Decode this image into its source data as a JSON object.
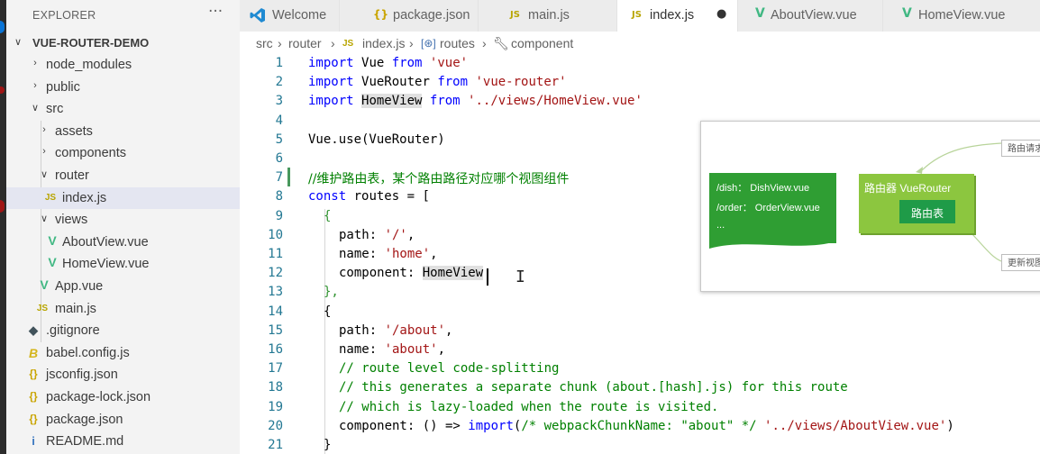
{
  "sidebar": {
    "title": "EXPLORER",
    "more": "···",
    "project": "VUE-ROUTER-DEMO",
    "items": [
      {
        "label": "node_modules"
      },
      {
        "label": "public"
      },
      {
        "label": "src"
      },
      {
        "label": "assets"
      },
      {
        "label": "components"
      },
      {
        "label": "router"
      },
      {
        "label": "index.js",
        "icon": "JS"
      },
      {
        "label": "views"
      },
      {
        "label": "AboutView.vue",
        "icon": "V"
      },
      {
        "label": "HomeView.vue",
        "icon": "V"
      },
      {
        "label": "App.vue",
        "icon": "V"
      },
      {
        "label": "main.js",
        "icon": "JS"
      },
      {
        "label": ".gitignore",
        "icon": "◆"
      },
      {
        "label": "babel.config.js",
        "icon": "B"
      },
      {
        "label": "jsconfig.json",
        "icon": "{}"
      },
      {
        "label": "package-lock.json",
        "icon": "{}"
      },
      {
        "label": "package.json",
        "icon": "{}"
      },
      {
        "label": "README.md",
        "icon": "i"
      }
    ]
  },
  "tabs": [
    {
      "label": "Welcome",
      "icon": "vscode-icon"
    },
    {
      "label": "package.json",
      "icon": "{}"
    },
    {
      "label": "main.js",
      "icon": "JS"
    },
    {
      "label": "index.js",
      "icon": "JS",
      "modified_dot": "●"
    },
    {
      "label": "AboutView.vue",
      "icon": "V"
    },
    {
      "label": "HomeView.vue",
      "icon": "V"
    }
  ],
  "breadcrumb": {
    "parts": [
      "src",
      "router",
      "index.js",
      "routes",
      "component"
    ],
    "sep": "›"
  },
  "code": {
    "line_numbers": [
      "1",
      "2",
      "3",
      "4",
      "5",
      "6",
      "7",
      "8",
      "9",
      "10",
      "11",
      "12",
      "13",
      "14",
      "15",
      "16",
      "17",
      "18",
      "19",
      "20",
      "21"
    ],
    "l1": [
      "import",
      "Vue",
      "from",
      "'vue'"
    ],
    "l2": [
      "import",
      "VueRouter",
      "from",
      "'vue-router'"
    ],
    "l3": [
      "import",
      "HomeView",
      "from",
      "'../views/HomeView.vue'"
    ],
    "l5": "Vue.use(VueRouter)",
    "l7": "//维护路由表，某个路由路径对应哪个视图组件",
    "l8": [
      "const",
      "routes = ["
    ],
    "l9": "{",
    "l10": [
      "path: ",
      "'/'",
      ","
    ],
    "l11": [
      "name: ",
      "'home'",
      ","
    ],
    "l12": [
      "component: ",
      "HomeView"
    ],
    "l13": "},",
    "l14": "{",
    "l15": [
      "path: ",
      "'/about'",
      ","
    ],
    "l16": [
      "name: ",
      "'about'",
      ","
    ],
    "l17": "// route level code-splitting",
    "l18": "// this generates a separate chunk (about.[hash].js) for this route",
    "l19": "// which is lazy-loaded when the route is visited.",
    "l20": [
      "component: () => ",
      "import",
      "(",
      "/* webpackChunkName: \"about\" */",
      " ",
      "'../views/AboutView.vue'",
      ")"
    ],
    "l21": "}"
  },
  "diagram": {
    "mapping_1": "/dish：  DishView.vue",
    "mapping_2": "/order：  OrderView.vue",
    "mapping_3": "...",
    "router_label": "路由器 VueRouter",
    "router_table": "路由表",
    "request_box": "路由请求",
    "update_box": "更新视图"
  },
  "colors": {
    "keyword": "#0000ff",
    "string": "#a31515",
    "comment": "#008000",
    "line_number": "#237893",
    "vue_green": "#41b883",
    "accent_blue": "#0a74d6"
  }
}
